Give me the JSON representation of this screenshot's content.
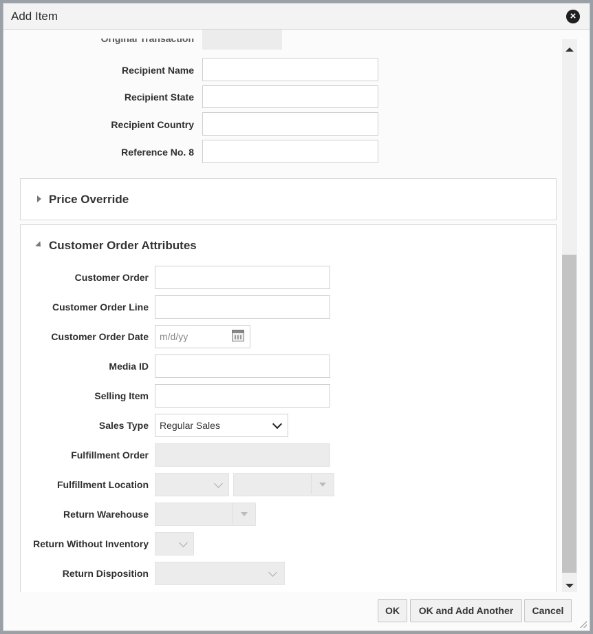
{
  "dialog": {
    "title": "Add Item"
  },
  "top_fields": {
    "cut_label": "Original Transaction",
    "recipient_name": "Recipient Name",
    "recipient_state": "Recipient State",
    "recipient_country": "Recipient Country",
    "reference_no_8": "Reference No. 8"
  },
  "price_override": {
    "title": "Price Override"
  },
  "customer_order": {
    "title": "Customer Order Attributes",
    "labels": {
      "customer_order": "Customer Order",
      "customer_order_line": "Customer Order Line",
      "customer_order_date": "Customer Order Date",
      "media_id": "Media ID",
      "selling_item": "Selling Item",
      "sales_type": "Sales Type",
      "fulfillment_order": "Fulfillment Order",
      "fulfillment_location": "Fulfillment Location",
      "return_warehouse": "Return Warehouse",
      "return_without_inventory": "Return Without Inventory",
      "return_disposition": "Return Disposition"
    },
    "date_placeholder": "m/d/yy",
    "sales_type_value": "Regular Sales"
  },
  "buttons": {
    "ok": "OK",
    "ok_add_another": "OK and Add Another",
    "cancel": "Cancel"
  }
}
